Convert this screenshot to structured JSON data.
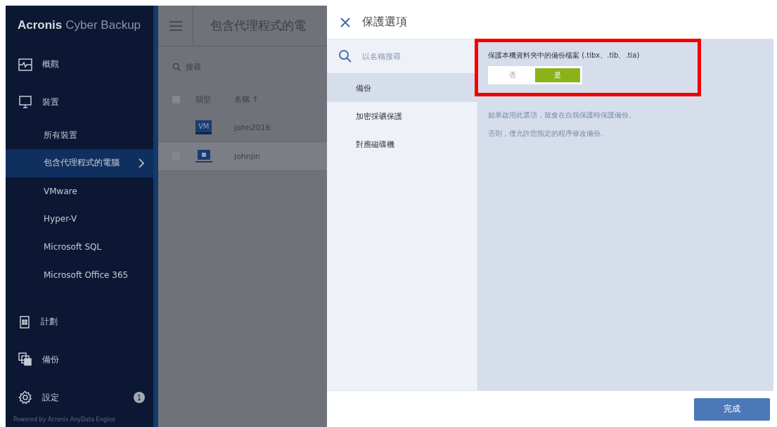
{
  "sidebar": {
    "logo": {
      "brand": "Acronis",
      "product": "Cyber Backup"
    },
    "items": [
      {
        "kind": "section",
        "label": "概觀",
        "selected": false
      },
      {
        "kind": "section",
        "label": "裝置",
        "selected": false
      },
      {
        "kind": "sub",
        "label": "所有裝置",
        "selected": false
      },
      {
        "kind": "sub",
        "label": "包含代理程式的電腦",
        "selected": true
      },
      {
        "kind": "sub",
        "label": "VMware",
        "selected": false
      },
      {
        "kind": "sub",
        "label": "Hyper-V",
        "selected": false
      },
      {
        "kind": "sub",
        "label": "Microsoft SQL",
        "selected": false
      },
      {
        "kind": "sub",
        "label": "Microsoft Office 365",
        "selected": false
      },
      {
        "kind": "section",
        "label": "計劃",
        "selected": false
      },
      {
        "kind": "section",
        "label": "備份",
        "selected": false
      },
      {
        "kind": "section",
        "label": "設定",
        "selected": false,
        "badge": "1"
      }
    ],
    "footer": "Powered by Acronis AnyData Engine"
  },
  "main": {
    "title": "包含代理程式的電",
    "search": {
      "placeholder": "搜尋"
    },
    "select_all_checked": false,
    "columns": [
      "類型",
      "名稱 ↑"
    ],
    "rows": [
      {
        "kind": "vm",
        "type_label": "VM",
        "name": "john2016",
        "selected": false
      },
      {
        "kind": "computer",
        "name": "johnjin",
        "selected": true,
        "checked": false
      }
    ]
  },
  "dialog": {
    "title": "保護選項",
    "search": {
      "placeholder": "以名稱搜尋"
    },
    "nav": [
      {
        "label": "備份",
        "selected": true
      },
      {
        "label": "加密採礦保護",
        "selected": false
      },
      {
        "label": "對應磁碟機",
        "selected": false
      }
    ],
    "option": {
      "label": "保護本機資料夾中的備份檔案 (.tibx、.tib、.tia)",
      "highlighted": true,
      "choices": [
        {
          "label": "否",
          "selected": false
        },
        {
          "label": "是",
          "selected": true
        }
      ]
    },
    "description": [
      "如果啟用此選項，就會在自我保護時保護備份。",
      "否則，僅允許您指定的程序修改備份。"
    ],
    "done_button": "完成"
  }
}
